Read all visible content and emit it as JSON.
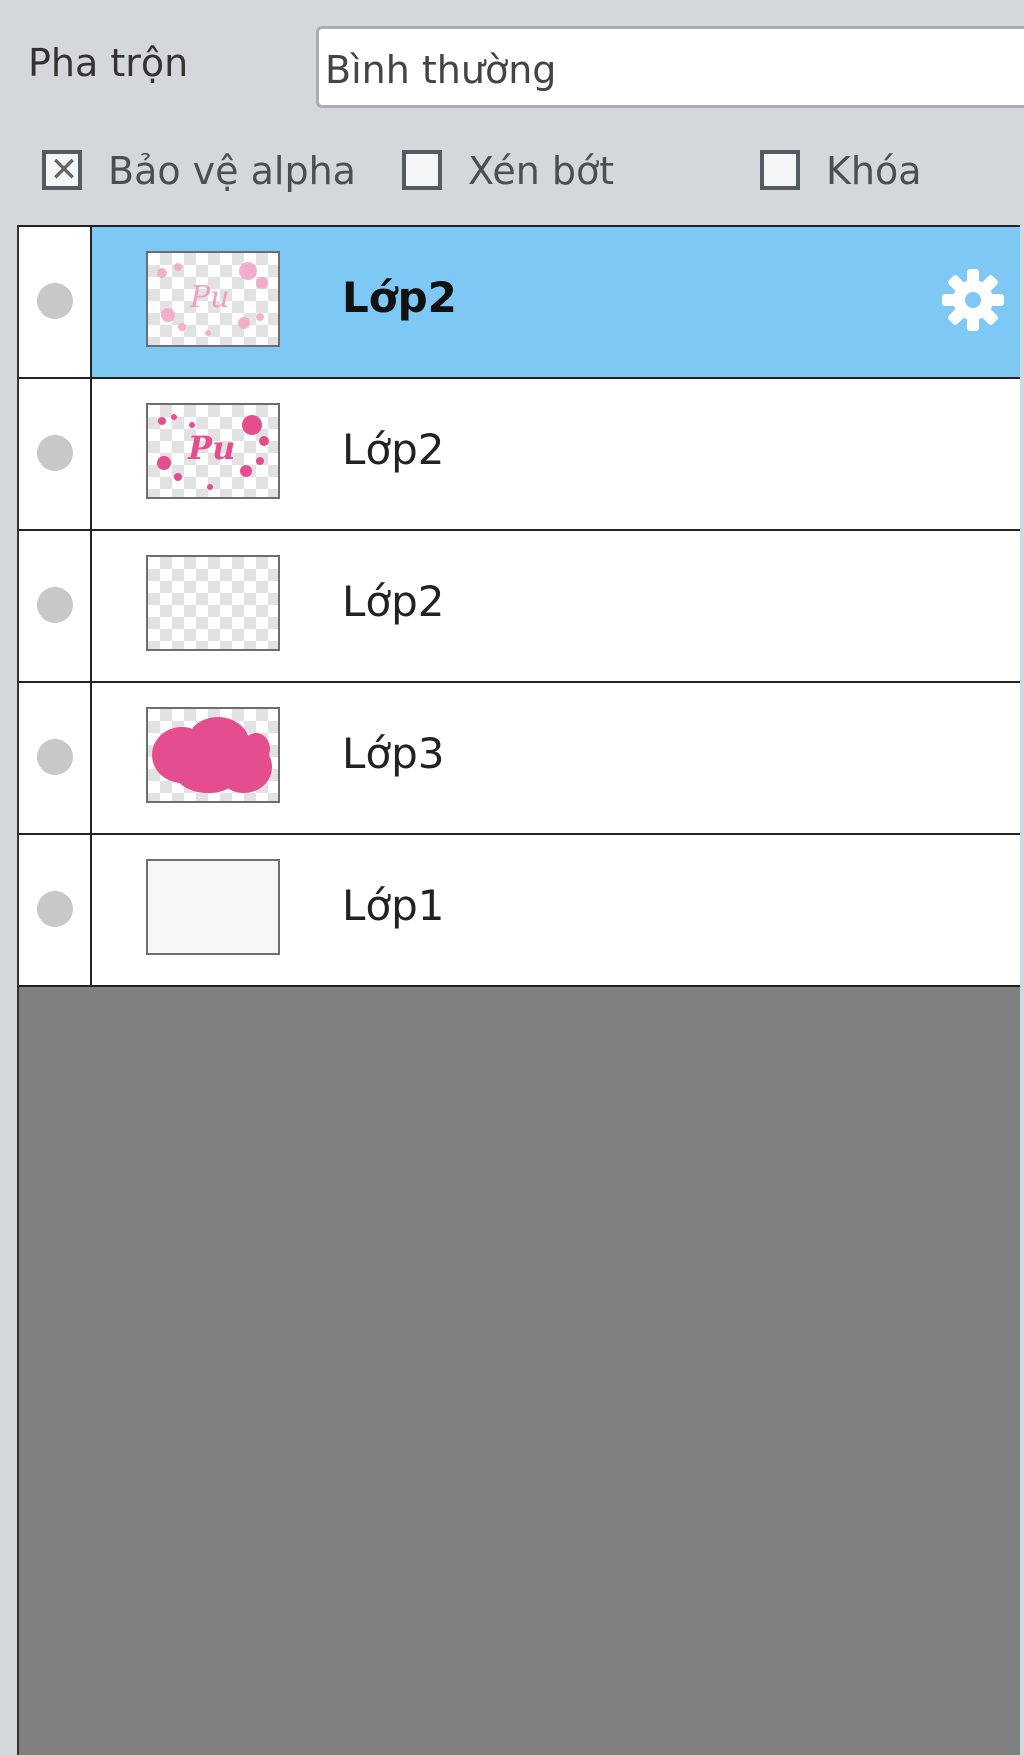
{
  "blend": {
    "label": "Pha trộn",
    "value": "Bình thường"
  },
  "options": [
    {
      "label": "Bảo vệ alpha",
      "checked": true
    },
    {
      "label": "Xén bớt",
      "checked": false
    },
    {
      "label": "Khóa",
      "checked": false
    }
  ],
  "colors": {
    "selected_row": "#7ec8f5",
    "empty_area": "#808080",
    "thumbnail_pink": "#e44e8e"
  },
  "layers": [
    {
      "name": "Lớp2",
      "selected": true,
      "thumbnail": "light-pink-text-icon",
      "settings_icon": "gear-icon"
    },
    {
      "name": "Lớp2",
      "selected": false,
      "thumbnail": "pink-text-icon"
    },
    {
      "name": "Lớp2",
      "selected": false,
      "thumbnail": "empty-transparent-icon"
    },
    {
      "name": "Lớp3",
      "selected": false,
      "thumbnail": "pink-blob-icon"
    },
    {
      "name": "Lớp1",
      "selected": false,
      "thumbnail": "blank-white-icon"
    }
  ]
}
